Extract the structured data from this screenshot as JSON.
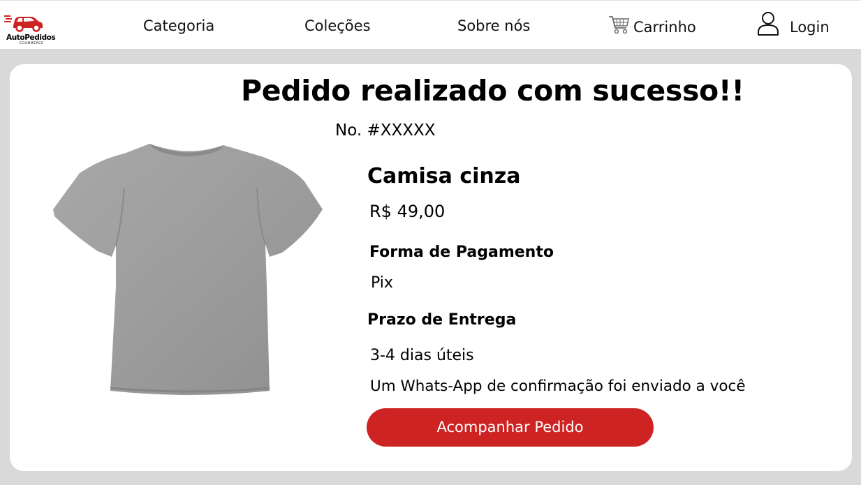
{
  "brand": {
    "name": "AutoPedidos",
    "tagline": "ECOMMERCE",
    "color": "#cd2323"
  },
  "nav": {
    "categoria": "Categoria",
    "colecoes": "Coleções",
    "sobre": "Sobre nós",
    "carrinho": "Carrinho",
    "carrinho_icon": "cart-icon",
    "login": "Login",
    "login_icon": "user-icon"
  },
  "order": {
    "title": "Pedido realizado com sucesso!!",
    "number": "No. #XXXXX",
    "product_name": "Camisa cinza",
    "product_image": "gray-tshirt",
    "price": "R$ 49,00",
    "payment_label": "Forma de Pagamento",
    "payment_value": "Pix",
    "delivery_label": "Prazo de Entrega",
    "delivery_value": "3-4 dias úteis",
    "confirmation": "Um Whats-App de confirmação foi enviado a você",
    "track_button": "Acompanhar Pedido"
  }
}
